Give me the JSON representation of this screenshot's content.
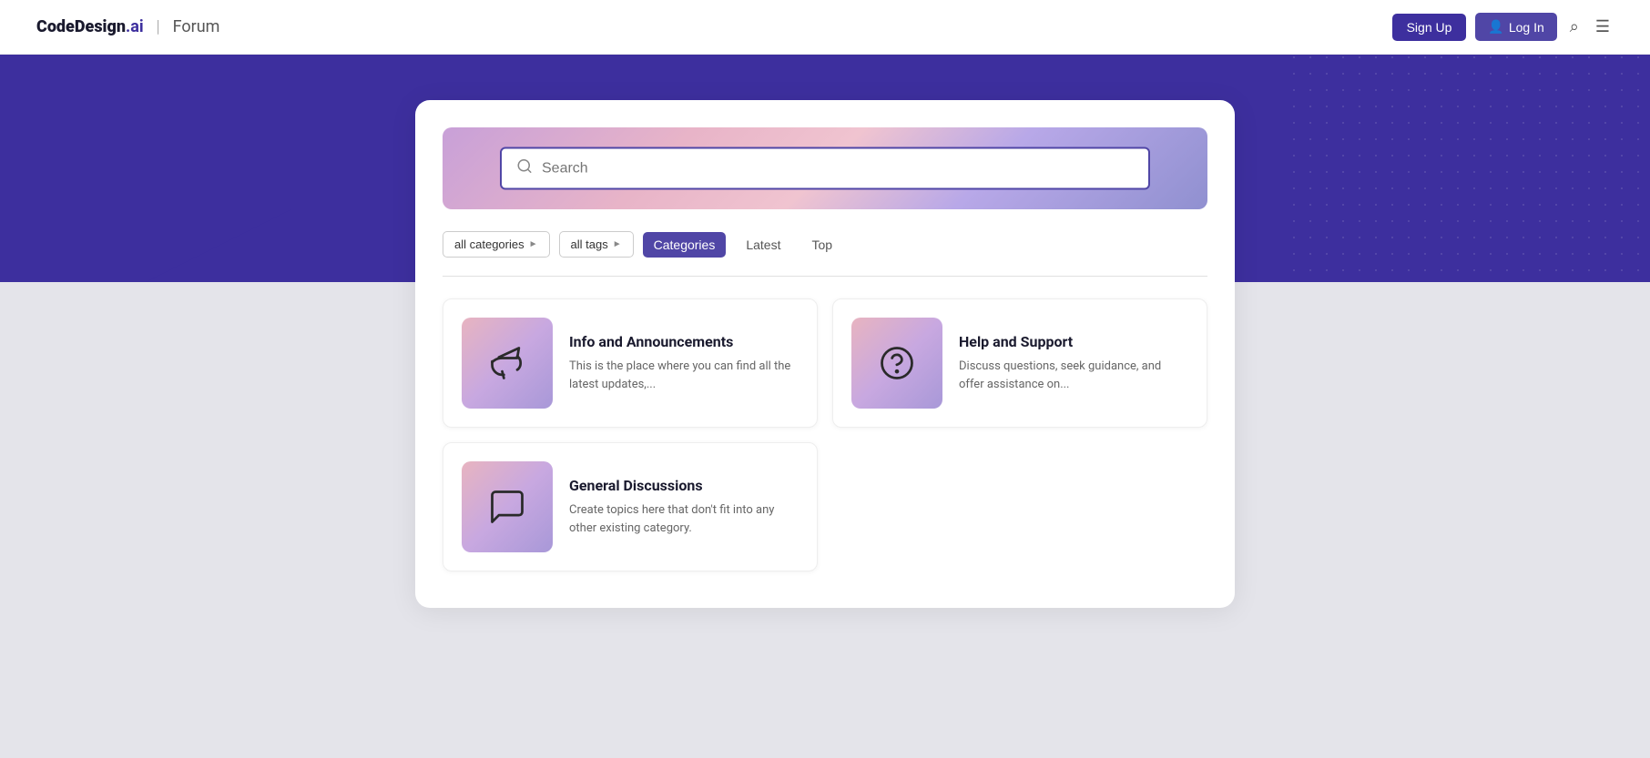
{
  "header": {
    "brand": "CodeDesign.ai",
    "brand_ai": ".ai",
    "separator": "|",
    "forum_label": "Forum",
    "signup_label": "Sign Up",
    "login_label": "Log In"
  },
  "search": {
    "placeholder": "Search"
  },
  "filters": {
    "categories_label": "all categories",
    "tags_label": "all tags",
    "tabs": [
      {
        "id": "categories",
        "label": "Categories",
        "active": true
      },
      {
        "id": "latest",
        "label": "Latest",
        "active": false
      },
      {
        "id": "top",
        "label": "Top",
        "active": false
      }
    ]
  },
  "categories": [
    {
      "id": "info-announcements",
      "title": "Info and Announcements",
      "description": "This is the place where you can find all the latest updates,...",
      "icon": "megaphone"
    },
    {
      "id": "help-support",
      "title": "Help and Support",
      "description": "Discuss questions, seek guidance, and offer assistance on...",
      "icon": "question-circle"
    },
    {
      "id": "general-discussions",
      "title": "General Discussions",
      "description": "Create topics here that don't fit into any other existing category.",
      "icon": "chat-bubble"
    }
  ]
}
